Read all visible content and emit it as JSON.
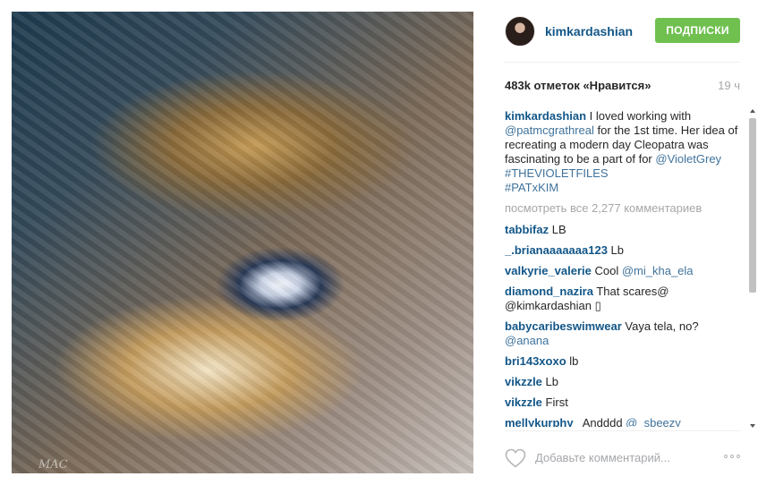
{
  "post": {
    "username": "kimkardashian",
    "follow_label": "ПОДПИСКИ",
    "likes": "483k отметок «Нравится»",
    "time": "19 ч",
    "photo_signature": "MAC"
  },
  "caption": {
    "username": "kimkardashian",
    "text1": " I loved working with ",
    "mention1": "@patmcgrathreal",
    "text2": " for the 1st time. Her idea of recreating a modern day Cleopatra was fascinating to be a part of for ",
    "mention2": "@VioletGrey",
    "space": " ",
    "tag1": "#THEVIOLETFILES",
    "tag2": "#PATxKIM"
  },
  "view_all": "посмотреть все 2,277 комментариев",
  "comments": [
    {
      "user": "tabbifaz",
      "text": " LB"
    },
    {
      "user": "_.brianaaaaaaa123",
      "text": " Lb"
    },
    {
      "user": "valkyrie_valerie",
      "text": " Cool ",
      "mention": "@mi_kha_ela"
    },
    {
      "user": "diamond_nazira",
      "text": " That scares@ @kimkardashian ▯"
    },
    {
      "user": "babycaribeswimwear",
      "text": " Vaya tela, no? ",
      "mention": "@anana"
    },
    {
      "user": "bri143xoxo",
      "text": " lb"
    },
    {
      "user": "vikzzle",
      "text": " Lb"
    },
    {
      "user": "vikzzle",
      "text": " First"
    },
    {
      "user": "mellykurphy_",
      "text": " Andddd ",
      "mention": "@_sbeezy_"
    }
  ],
  "add_comment_placeholder": "Добавьте комментарий...",
  "icons": {
    "avatar": "profile-avatar",
    "like": "heart-outline-icon",
    "more": "more-options-icon"
  },
  "colors": {
    "link": "#125688",
    "follow": "#70c050",
    "muted": "#a5a7aa"
  }
}
